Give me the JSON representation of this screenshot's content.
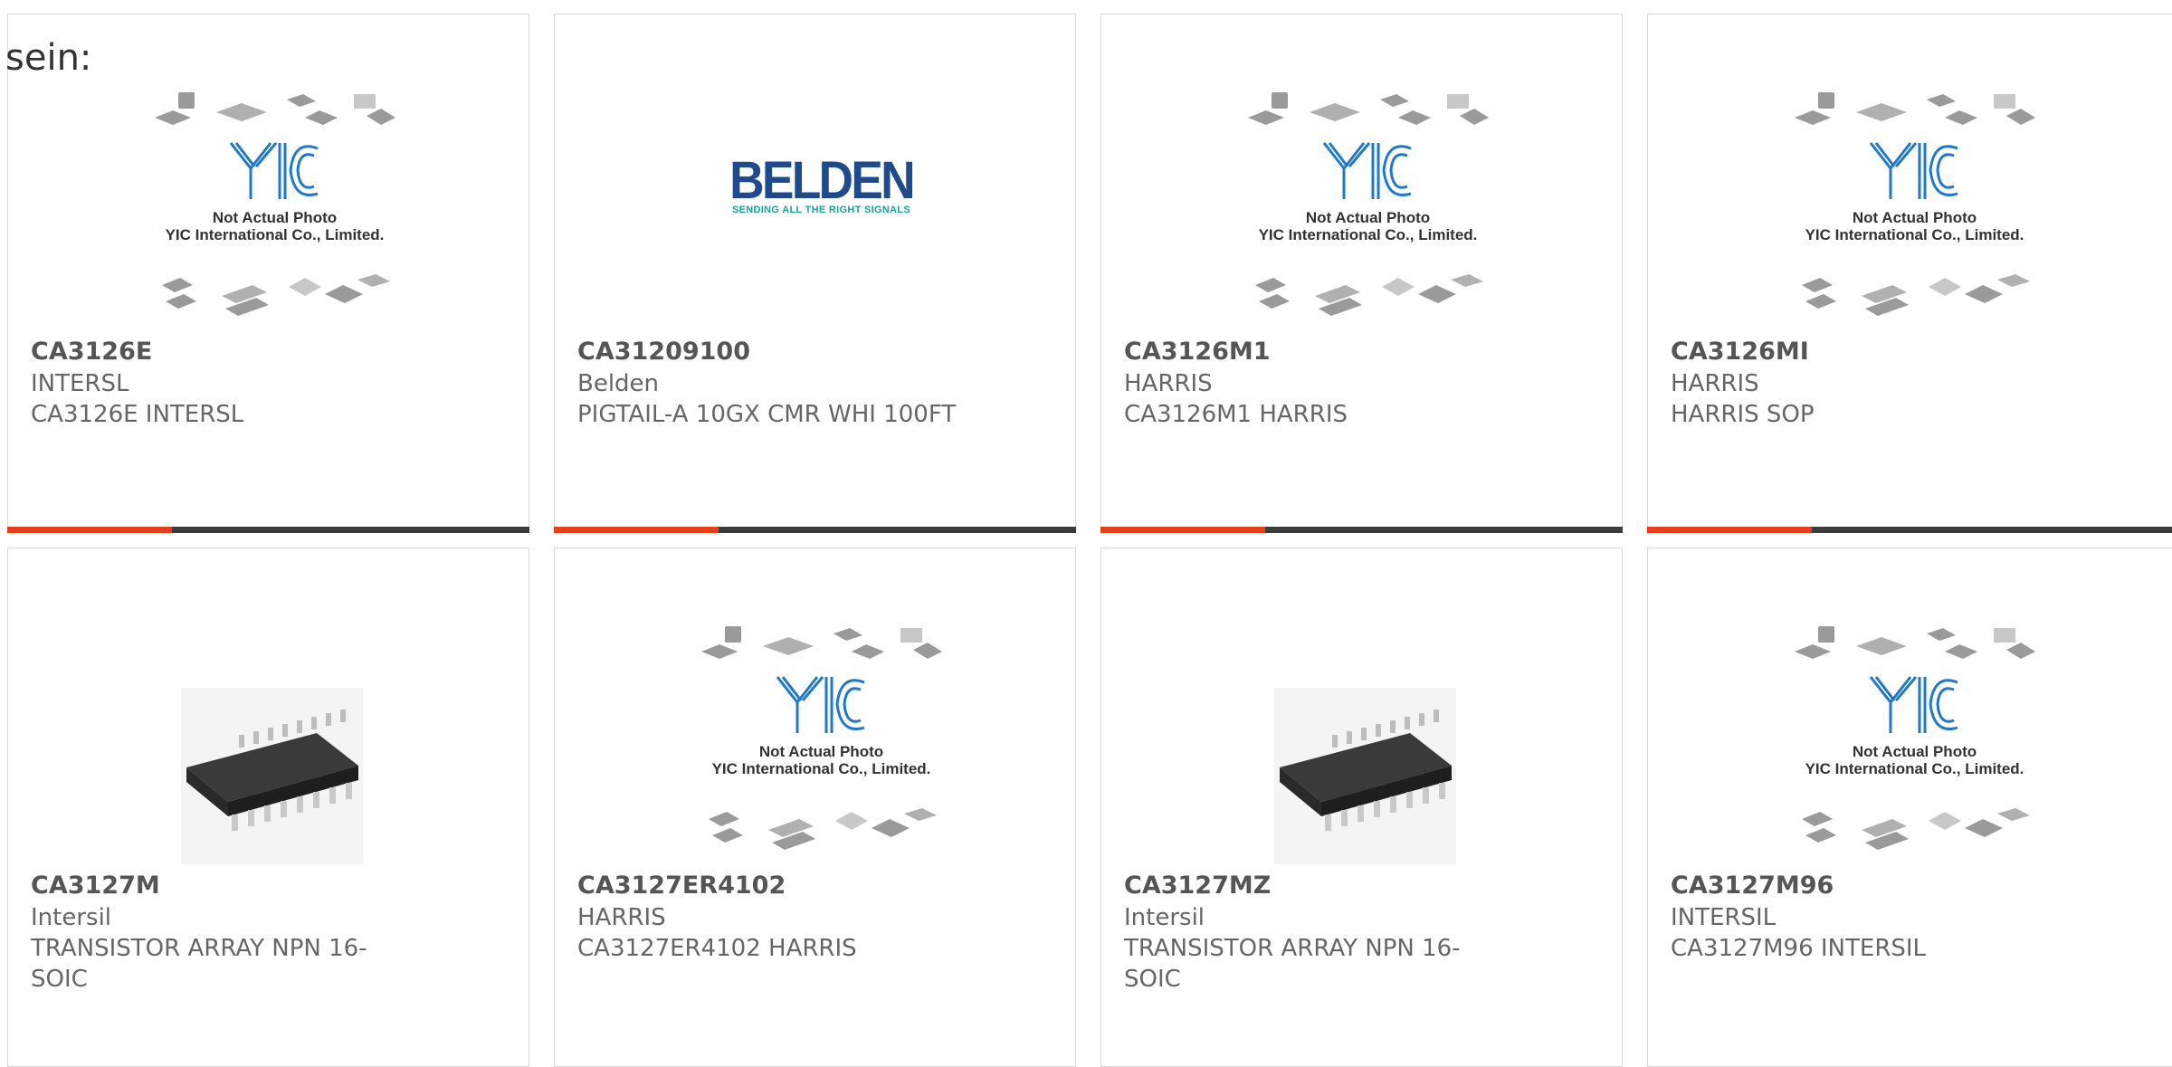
{
  "page_fragment": "sein:",
  "placeholder": {
    "line1": "Not Actual Photo",
    "line2": "YIC International Co., Limited."
  },
  "belden_logo": {
    "word": "BELDEN",
    "tagline": "SENDING ALL THE RIGHT SIGNALS"
  },
  "colors": {
    "accent": "#e5401b",
    "bar": "#3b3b3b",
    "title": "#555555",
    "text": "#666666",
    "yic_blue": "#1f78c8"
  },
  "products": [
    {
      "part": "CA3126E",
      "manufacturer": "INTERSL",
      "description": "CA3126E INTERSL",
      "image": "not-actual-photo-placeholder"
    },
    {
      "part": "CA31209100",
      "manufacturer": "Belden",
      "description": "PIGTAIL-A 10GX CMR WHI 100FT",
      "image": "belden-logo"
    },
    {
      "part": "CA3126M1",
      "manufacturer": "HARRIS",
      "description": "CA3126M1 HARRIS",
      "image": "not-actual-photo-placeholder"
    },
    {
      "part": "CA3126MI",
      "manufacturer": "HARRIS",
      "description": "HARRIS SOP",
      "image": "not-actual-photo-placeholder"
    },
    {
      "part": "CA3127M",
      "manufacturer": "Intersil",
      "description": "TRANSISTOR ARRAY NPN 16-SOIC",
      "image": "soic-chip-photo"
    },
    {
      "part": "CA3127ER4102",
      "manufacturer": "HARRIS",
      "description": "CA3127ER4102 HARRIS",
      "image": "not-actual-photo-placeholder"
    },
    {
      "part": "CA3127MZ",
      "manufacturer": "Intersil",
      "description": "TRANSISTOR ARRAY NPN 16-SOIC",
      "image": "soic-chip-photo"
    },
    {
      "part": "CA3127M96",
      "manufacturer": "INTERSIL",
      "description": "CA3127M96 INTERSIL",
      "image": "not-actual-photo-placeholder"
    }
  ]
}
